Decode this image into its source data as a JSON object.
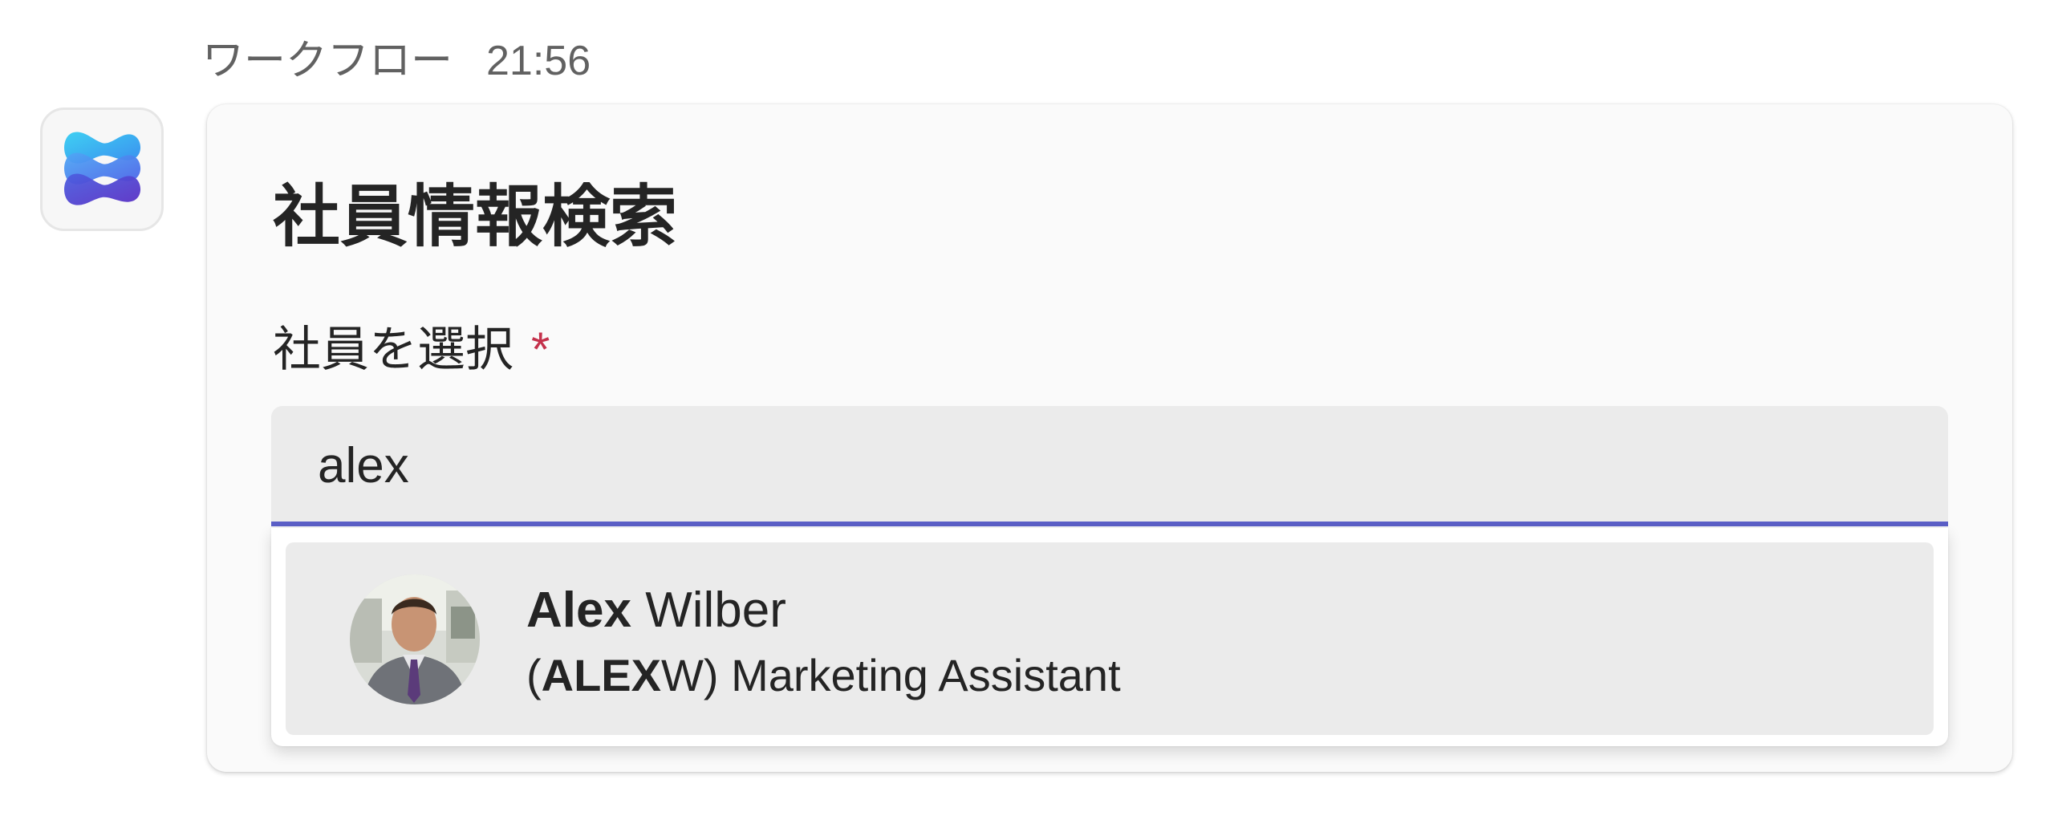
{
  "message": {
    "sender": "ワークフロー",
    "time": "21:56"
  },
  "bot_avatar": {
    "icon": "workflows-logo-icon",
    "colors": [
      "#3ec6f0",
      "#4a6cf0",
      "#5b3fd6"
    ]
  },
  "card": {
    "title": "社員情報検索",
    "field_label": "社員を選択",
    "required_mark": "*",
    "search": {
      "value": "alex",
      "accent_color": "#5b5fc7"
    },
    "suggestions": [
      {
        "name_match": "Alex",
        "name_rest": " Wilber",
        "sub_open": "(",
        "sub_match": "ALEX",
        "sub_rest": "W) Marketing Assistant",
        "photo": "person-photo"
      }
    ]
  }
}
